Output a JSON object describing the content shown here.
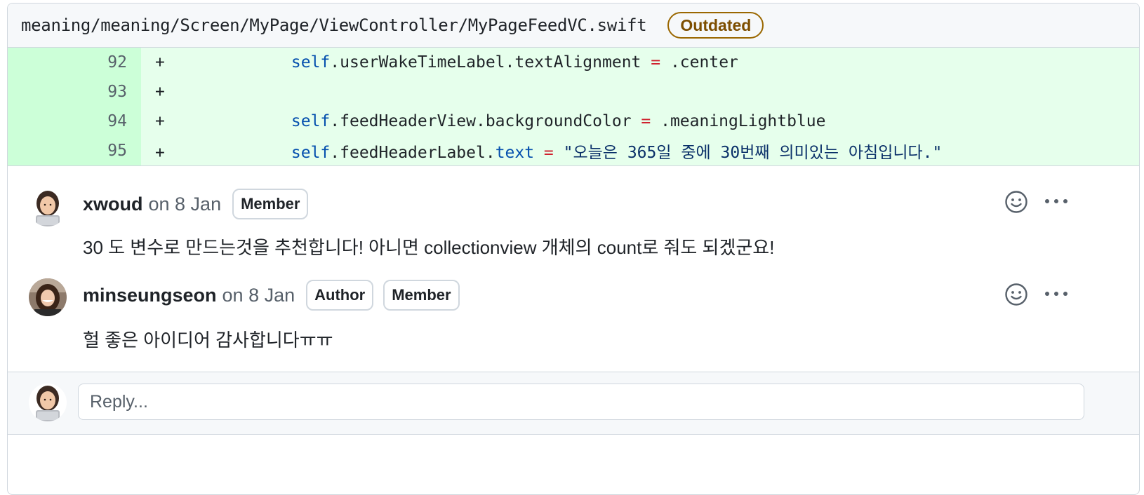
{
  "file": {
    "path": "meaning/meaning/Screen/MyPage/ViewController/MyPageFeedVC.swift",
    "status_badge": "Outdated"
  },
  "diff": {
    "lines": [
      {
        "num": "92",
        "sign": "+",
        "indent": "        ",
        "self": "self",
        "a": ".userWakeTimeLabel.textAlignment ",
        "op": "=",
        "b": " .center",
        "prop": "",
        "str": ""
      },
      {
        "num": "93",
        "sign": "+",
        "indent": "",
        "self": "",
        "a": "",
        "op": "",
        "b": "",
        "prop": "",
        "str": ""
      },
      {
        "num": "94",
        "sign": "+",
        "indent": "        ",
        "self": "self",
        "a": ".feedHeaderView.backgroundColor ",
        "op": "=",
        "b": " .meaningLightblue",
        "prop": "",
        "str": ""
      },
      {
        "num": "95",
        "sign": "+",
        "indent": "        ",
        "self": "self",
        "a": ".feedHeaderLabel.",
        "prop": "text",
        "op": " =",
        "b": " ",
        "str": "\"오늘은 365일 중에 30번째 의미있는 아침입니다.\""
      }
    ]
  },
  "comments": [
    {
      "author": "xwoud",
      "when": "on 8 Jan",
      "badges": [
        "Member"
      ],
      "body": "30 도 변수로 만드는것을 추천합니다! 아니면 collectionview 개체의 count로 줘도 되겠군요!"
    },
    {
      "author": "minseungseon",
      "when": "on 8 Jan",
      "badges": [
        "Author",
        "Member"
      ],
      "body": "헐 좋은 아이디어 감사합니다ㅠㅠ"
    }
  ],
  "reply": {
    "placeholder": "Reply..."
  },
  "colors": {
    "diff_add_bg": "#e6ffec",
    "diff_add_num_bg": "#ccffd8",
    "outdated": "#9a6700",
    "keyword": "#0550ae",
    "operator": "#cf222e",
    "string": "#0a3069"
  },
  "icons": {
    "reaction": "smiley-icon",
    "more": "kebab-horizontal-icon",
    "avatar_xwoud": "memoji-avatar",
    "avatar_minseungseon": "photo-avatar"
  }
}
